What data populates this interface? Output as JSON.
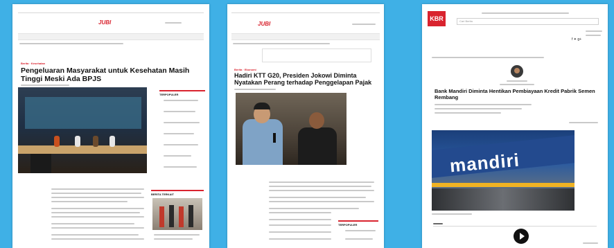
{
  "page1": {
    "site_logo": "JUBI",
    "category": "Berita · Kesehatan",
    "headline": "Pengeluaran Masyarakat untuk Kesehatan Masih Tinggi Meski Ada BPJS",
    "sidebar_title": "TERPOPULER",
    "sidebar2_title": "BERITA TERKAIT"
  },
  "page2": {
    "site_logo": "JUBI",
    "category": "Berita · Ekonomi",
    "headline": "Hadiri KTT G20, Presiden Jokowi Diminta Nyatakan Perang terhadap Penggelapan Pajak",
    "sidebar_title": "TERPOPULER"
  },
  "page3": {
    "site_logo": "KBR",
    "search_placeholder": "Cari Berita",
    "headline": "Bank Mandiri Diminta Hentikan Pembiayaan Kredit Pabrik Semen Rembang",
    "photo_text": "mandiri"
  },
  "colors": {
    "background": "#3fb0e6",
    "accent": "#d9232e"
  },
  "icons": [
    "play-icon",
    "facebook-icon",
    "twitter-icon",
    "google-plus-icon"
  ]
}
